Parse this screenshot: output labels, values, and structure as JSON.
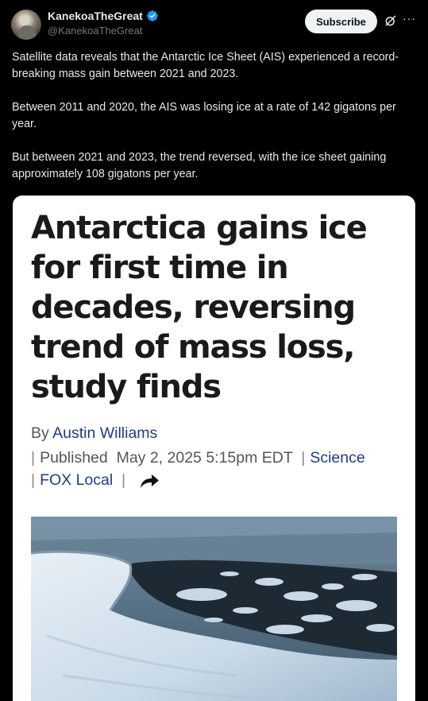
{
  "post": {
    "display_name": "KanekoaTheGreat",
    "handle": "@KanekoaTheGreat",
    "subscribe_label": "Subscribe",
    "more_label": "···",
    "paragraphs": [
      "Satellite data reveals that the Antarctic Ice Sheet (AIS) experienced a record-breaking mass gain between 2021 and 2023.",
      "Between 2011 and 2020, the AIS was losing ice at a rate of 142 gigatons per year.",
      "But between 2021 and 2023, the trend reversed, with the ice sheet gaining approximately 108 gigatons per year."
    ]
  },
  "article": {
    "headline": "Antarctica gains ice for first time in decades, reversing trend of mass loss, study finds",
    "by_prefix": "By",
    "author": "Austin Williams",
    "published_label": "Published",
    "date": "May 2, 2025 5:15pm EDT",
    "category": "Science",
    "source": "FOX Local"
  },
  "colors": {
    "background": "#000000",
    "verified": "#1d9bf0",
    "link": "#1f3c88"
  }
}
